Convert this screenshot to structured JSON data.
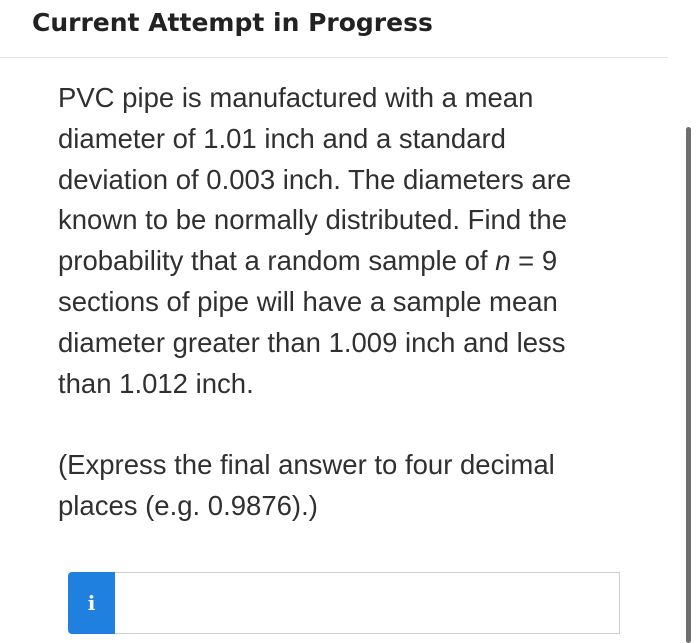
{
  "header": {
    "title": "Current Attempt in Progress"
  },
  "question": {
    "text_before_n": "PVC pipe is manufactured with a mean diameter of 1.01 inch and a standard deviation of 0.003 inch. The diameters are known to be normally distributed. Find the probability that a random sample of ",
    "variable": "n",
    "text_after_n": " = 9 sections of pipe will have a sample mean diameter greater than 1.009 inch and less than 1.012 inch.",
    "instruction": "(Express the final answer to four decimal places (e.g. 0.9876).)"
  },
  "answer": {
    "info_icon": "info-icon",
    "info_glyph": "i",
    "value": ""
  },
  "colors": {
    "accent": "#1f80e0",
    "text": "#303030",
    "header_text": "#222222"
  }
}
